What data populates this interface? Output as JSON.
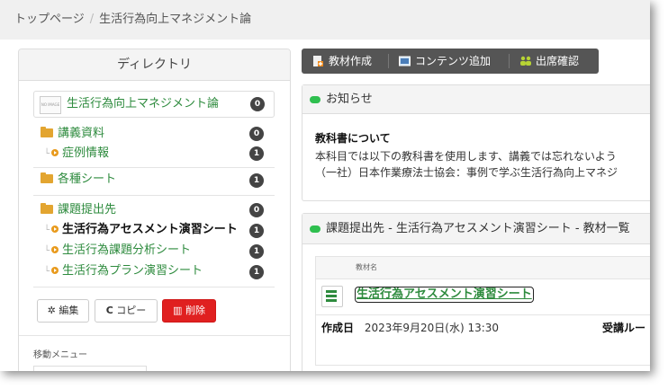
{
  "breadcrumb": {
    "home": "トップページ",
    "separator": "/",
    "current": "生活行為向上マネジメント論"
  },
  "directory": {
    "header": "ディレクトリ",
    "course": {
      "thumb_text": "NO IMAGE",
      "title": "生活行為向上マネジメント論",
      "count": "0"
    },
    "items": [
      {
        "label": "講義資料",
        "count": "0",
        "kind": "folder"
      },
      {
        "label": "症例情報",
        "count": "1",
        "kind": "material"
      },
      {
        "label": "各種シート",
        "count": "1",
        "kind": "folder"
      },
      {
        "label": "課題提出先",
        "count": "0",
        "kind": "folder"
      },
      {
        "label": "生活行為アセスメント演習シート",
        "count": "1",
        "kind": "material-active"
      },
      {
        "label": "生活行為課題分析シート",
        "count": "1",
        "kind": "material"
      },
      {
        "label": "生活行為プラン演習シート",
        "count": "1",
        "kind": "material"
      }
    ],
    "buttons": {
      "edit": "編集",
      "copy": "コピー",
      "delete": "削除"
    },
    "move_menu": "移動メニュー"
  },
  "toolbar": {
    "create": "教材作成",
    "add_content": "コンテンツ追加",
    "attendance": "出席確認"
  },
  "notice": {
    "header": "お知らせ",
    "title": "教科書について",
    "line1": "本科目では以下の教科書を使用します、講義では忘れないよう",
    "line2": "（一社）日本作業療法士協会：事例で学ぶ生活行為向上マネジ"
  },
  "assignment": {
    "header": "課題提出先 - 生活行為アセスメント演習シート - 教材一覧",
    "column_label": "教材名",
    "material_title": "生活行為アセスメント演習シート",
    "created_label": "作成日",
    "created_value": "2023年9月20日(水) 13:30",
    "route_label": "受講ルー"
  },
  "colors": {
    "accent_green": "#2e8b3e",
    "badge": "#444444",
    "delete_red": "#e02020",
    "toolbar": "#555555"
  }
}
